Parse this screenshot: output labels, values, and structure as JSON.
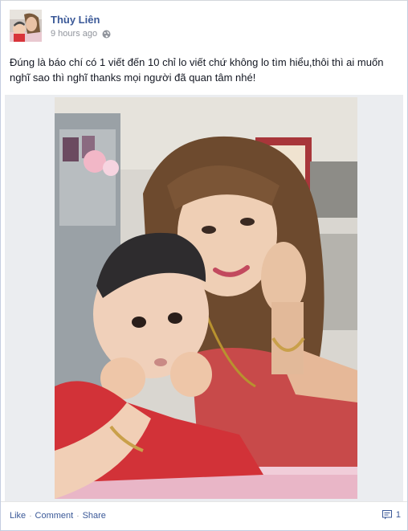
{
  "post": {
    "author": "Thùy Liên",
    "timestamp": "9 hours ago",
    "privacy_icon": "globe-icon",
    "text": "Đúng là báo chí có 1 viết đến 10 chỉ lo viết chứ không lo tìm hiểu,thôi thì ai muốn nghĩ sao thì nghĩ thanks mọi người đã quan tâm nhé!"
  },
  "actions": {
    "like": "Like",
    "comment": "Comment",
    "share": "Share",
    "separator": "·"
  },
  "comment_count": "1",
  "colors": {
    "link": "#3b5998",
    "meta": "#90949c",
    "text": "#141823",
    "photo_bg": "#ebedf0"
  }
}
